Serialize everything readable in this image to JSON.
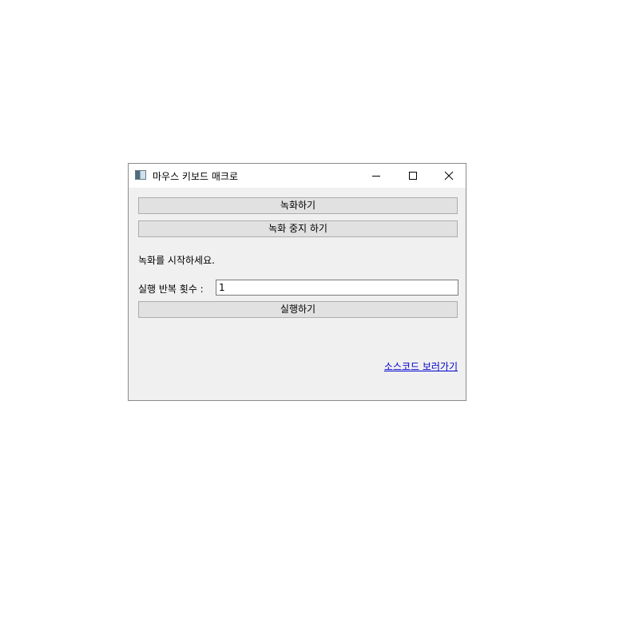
{
  "window": {
    "title": "마우스 키보드 매크로"
  },
  "buttons": {
    "record": "녹화하기",
    "stop_record": "녹화 중지 하기",
    "run": "실행하기"
  },
  "status_text": "녹화를 시작하세요.",
  "repeat": {
    "label": "실행 반복 횟수 :",
    "value": "1"
  },
  "source_link": "소스코드 보러가기",
  "icons": {
    "app": "app-window-icon",
    "minimize": "minimize-icon",
    "maximize": "maximize-icon",
    "close": "close-icon"
  }
}
